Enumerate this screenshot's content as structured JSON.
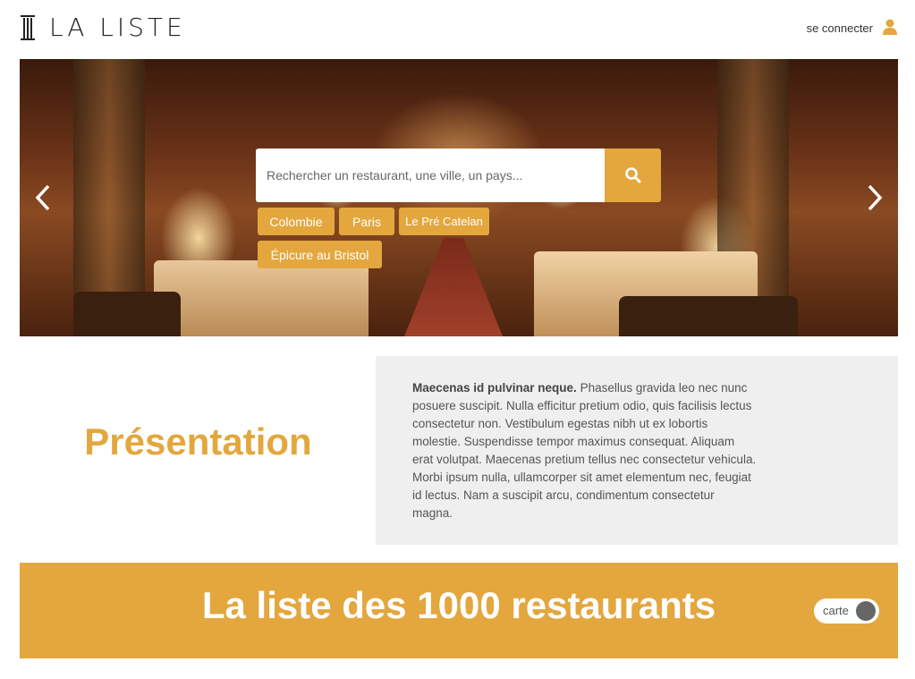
{
  "header": {
    "logo_text": "LA LISTE",
    "login_label": "se connecter",
    "login_icon": "user-icon"
  },
  "hero": {
    "search": {
      "placeholder": "Rechercher un restaurant, une ville, un pays..."
    },
    "search_icon": "search-icon",
    "prev_icon": "chevron-left-icon",
    "next_icon": "chevron-right-icon",
    "suggestions": [
      "Colombie",
      "Paris",
      "Le Pré Catelan",
      "Épicure au Bristol"
    ]
  },
  "presentation": {
    "title": "Présentation",
    "lead": "Maecenas id pulvinar neque.",
    "body": " Phasellus gravida leo nec nunc posuere suscipit. Nulla efficitur pretium odio, quis facilisis lectus consectetur non. Vestibulum egestas nibh ut ex lobortis molestie. Suspendisse tempor maximus consequat. Aliquam erat volutpat. Maecenas pretium tellus nec consectetur vehicula. Morbi ipsum nulla, ullamcorper sit amet elementum nec, feugiat id lectus. Nam a suscipit arcu, condimentum consectetur magna."
  },
  "banner": {
    "title": "La liste des 1000 restaurants",
    "toggle_label": "carte"
  },
  "colors": {
    "accent": "#e3a73e",
    "panel": "#efefef"
  }
}
